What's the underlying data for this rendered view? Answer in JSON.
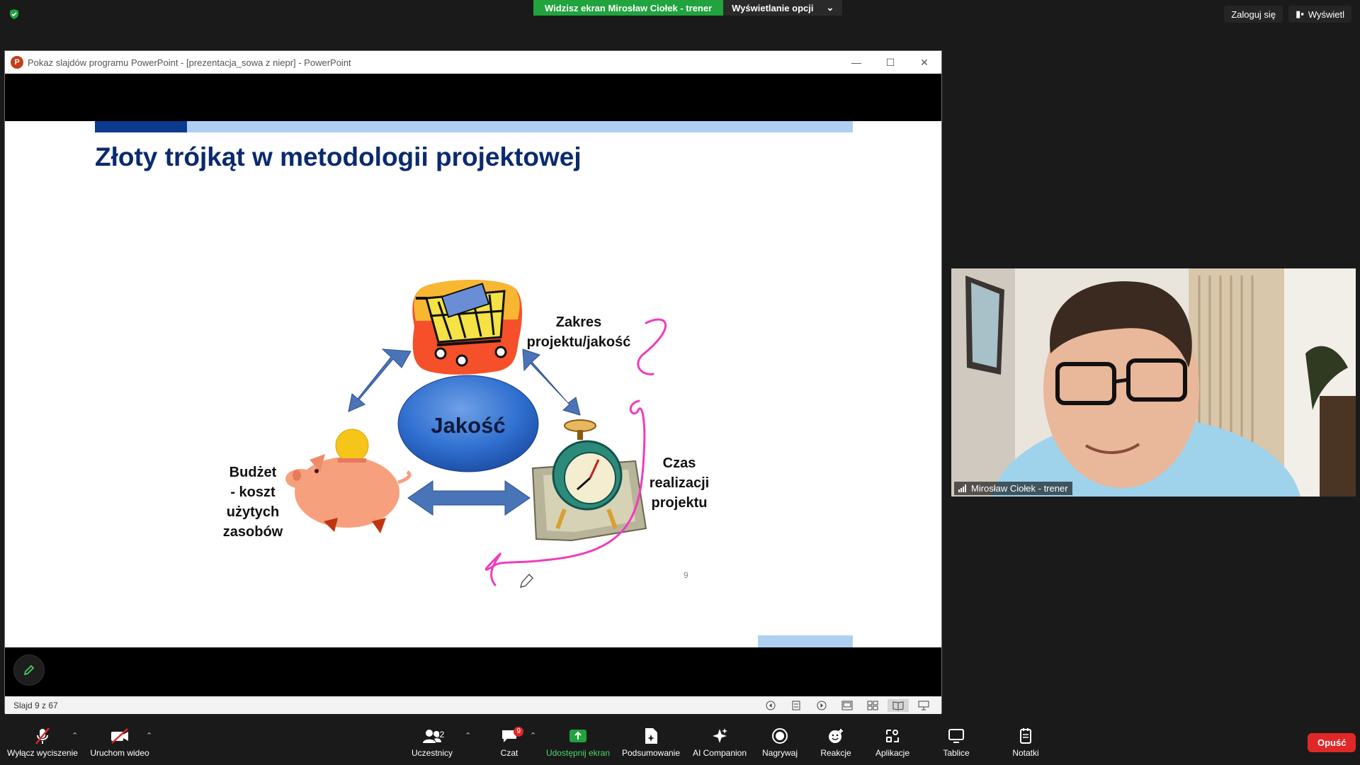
{
  "top": {
    "share_banner": "Widzisz ekran Mirosław Ciołek - trener",
    "view_options": "Wyświetlanie opcji",
    "sign_in": "Zaloguj się",
    "view": "Wyświetl"
  },
  "powerpoint": {
    "window_title": "Pokaz slajdów programu PowerPoint - [prezentacja_sowa z niepr] - PowerPoint",
    "slide_counter": "Slajd 9 z 67"
  },
  "slide": {
    "title": "Złoty trójkąt w metodologii projektowej",
    "center_label": "Jakość",
    "scope_label": "Zakres\nprojektu/jakość",
    "time_label": "Czas\nrealizacji\nprojektu",
    "budget_label": "Budżet\n- koszt\nużytych\nzasobów",
    "page_number": "9"
  },
  "video": {
    "participant_name": "Mirosław Ciołek - trener"
  },
  "toolbar": {
    "mute": "Wyłącz wyciszenie",
    "video": "Uruchom wideo",
    "participants": "Uczestnicy",
    "participants_count": "32",
    "chat": "Czat",
    "chat_badge": "9",
    "share": "Udostępnij ekran",
    "summary": "Podsumowanie",
    "ai": "AI Companion",
    "record": "Nagrywaj",
    "reactions": "Reakcje",
    "apps": "Aplikacje",
    "whiteboards": "Tablice",
    "notes": "Notatki",
    "leave": "Opuść"
  },
  "colors": {
    "zoom_green": "#21a33e",
    "leave_red": "#e02828",
    "slide_title_blue": "#0b2a6e",
    "arrow_blue": "#4a74b8",
    "annotation_pink": "#f03cbc"
  }
}
